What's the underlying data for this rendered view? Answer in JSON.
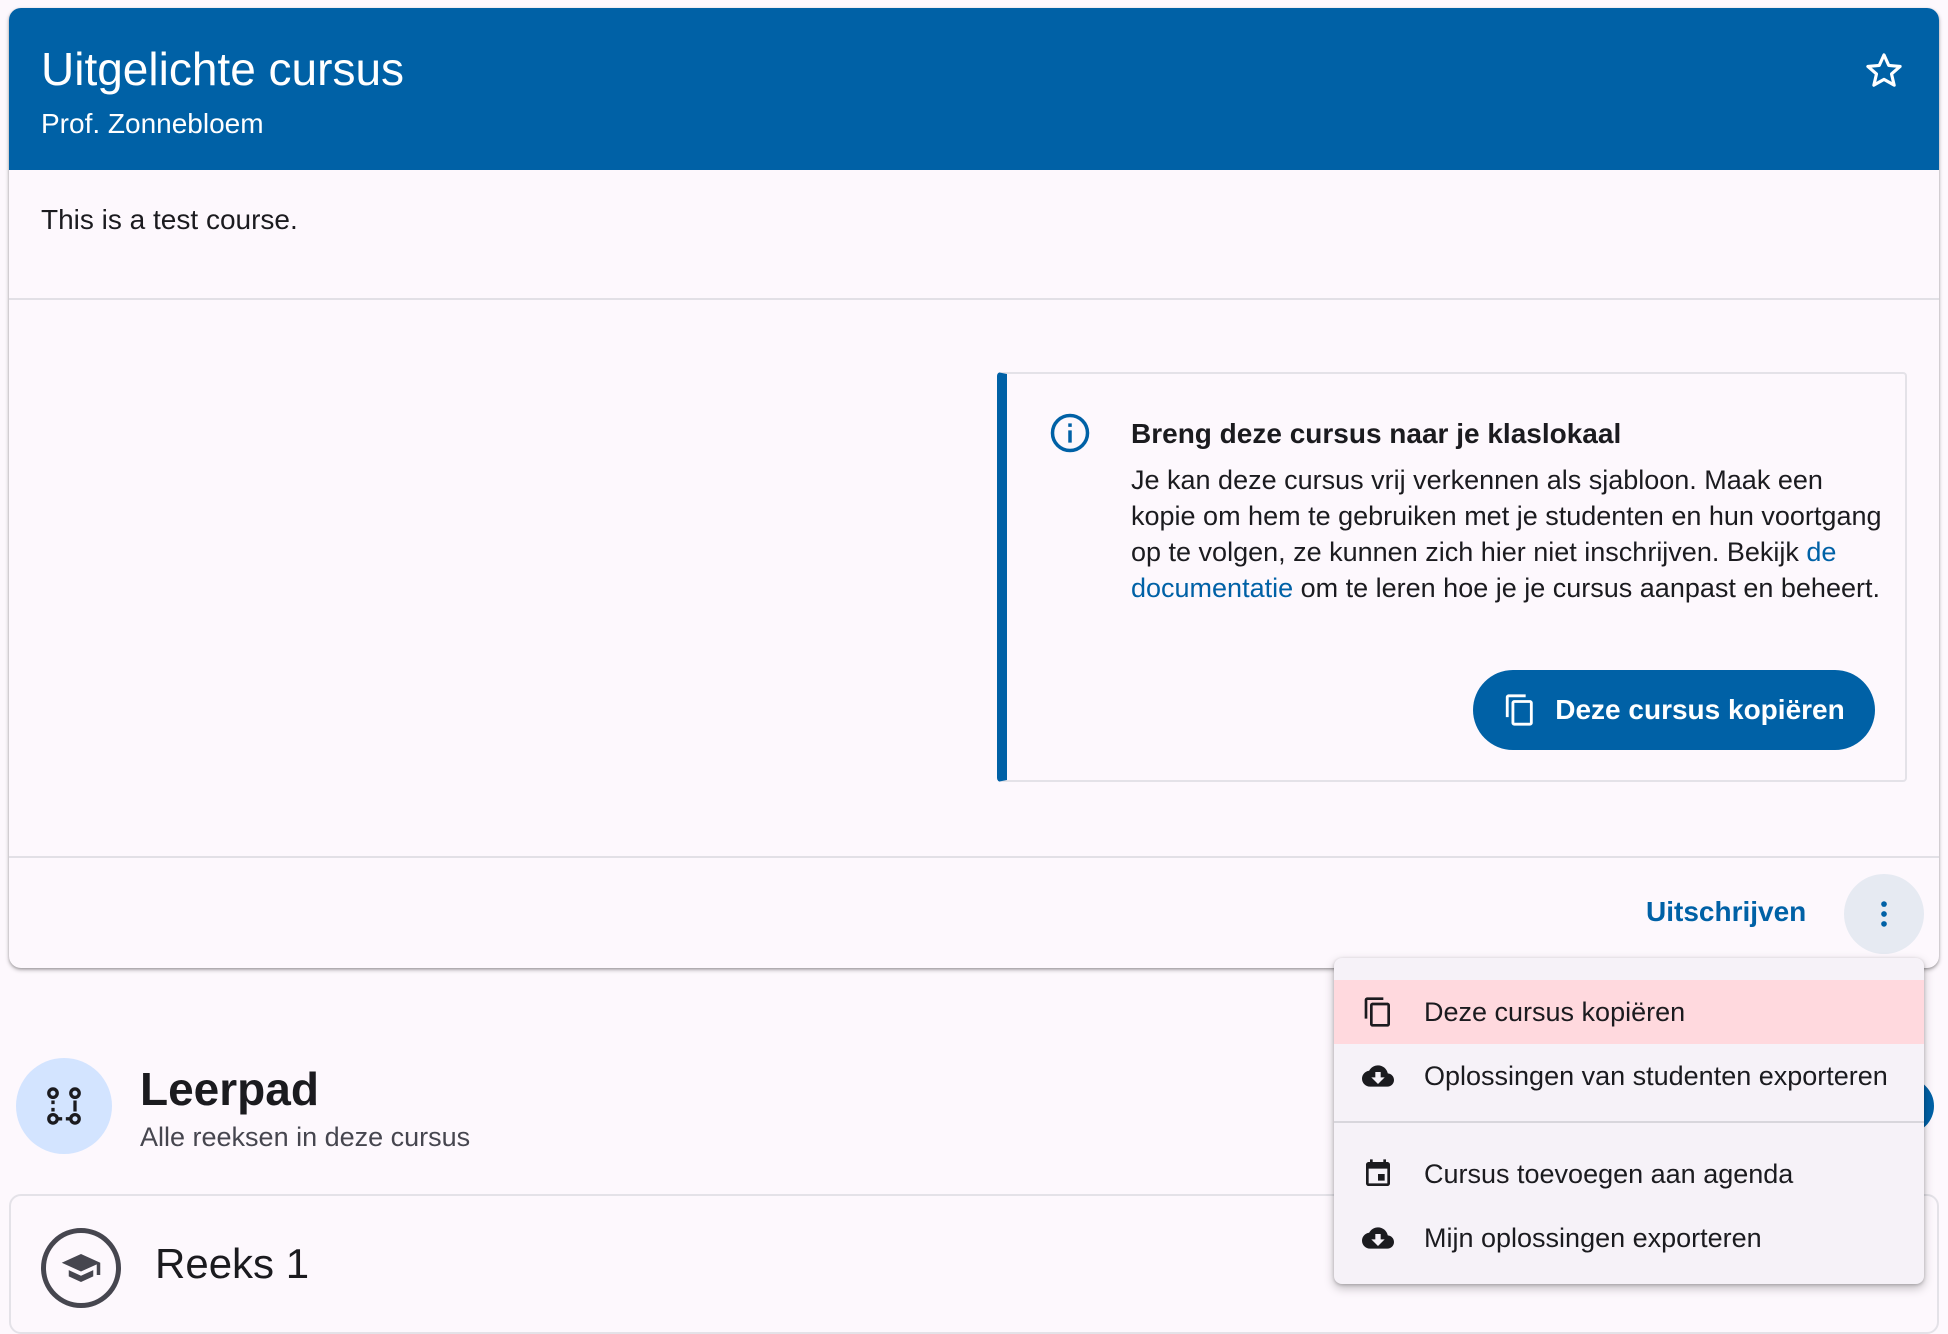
{
  "course": {
    "title": "Uitgelichte cursus",
    "teacher": "Prof. Zonnebloem",
    "description": "This is a test course."
  },
  "info": {
    "title": "Breng deze cursus naar je klaslokaal",
    "body_before": "Je kan deze cursus vrij verkennen als sjabloon. Maak een kopie om hem te gebruiken met je studenten en hun voortgang op te volgen, ze kunnen zich hier niet inschrijven. Bekijk ",
    "link_text": "de documentatie",
    "body_after": " om te leren hoe je je cursus aanpast en beheert.",
    "copy_button": "Deze cursus kopiëren"
  },
  "actions": {
    "unsubscribe": "Uitschrijven"
  },
  "menu": {
    "items": [
      {
        "label": "Deze cursus kopiëren",
        "icon": "copy-icon"
      },
      {
        "label": "Oplossingen van studenten exporteren",
        "icon": "cloud-download-icon"
      },
      {
        "label": "Cursus toevoegen aan agenda",
        "icon": "calendar-icon"
      },
      {
        "label": "Mijn oplossingen exporteren",
        "icon": "cloud-download-icon"
      }
    ]
  },
  "learning_path": {
    "title": "Leerpad",
    "subtitle": "Alle reeksen in deze cursus"
  },
  "series": [
    {
      "title": "Reeks 1"
    }
  ],
  "colors": {
    "primary": "#0061a6",
    "highlight": "#ffd9de"
  }
}
